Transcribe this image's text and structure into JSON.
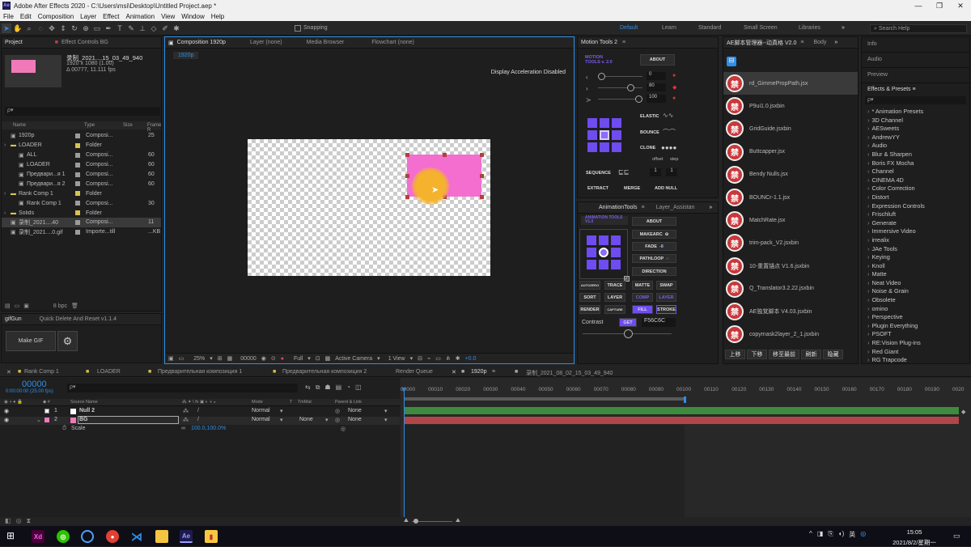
{
  "window": {
    "title": "Adobe After Effects 2020 - C:\\Users\\msi\\Desktop\\Untitled Project.aep *",
    "controls": [
      "—",
      "❐",
      "✕"
    ]
  },
  "menu": [
    "File",
    "Edit",
    "Composition",
    "Layer",
    "Effect",
    "Animation",
    "View",
    "Window",
    "Help"
  ],
  "toolbar": {
    "snapping": "Snapping",
    "workspaces": [
      "Default",
      "Learn",
      "Standard",
      "Small Screen",
      "Libraries"
    ],
    "search_placeholder": "Search Help"
  },
  "project": {
    "tab": "Project",
    "effect_controls": "Effect Controls BG",
    "thumb_name": "录制_2021....15_03_49_940",
    "thumb_info1": "1920 x 1080 (1.00)",
    "thumb_info2": "Δ 00777, 11.111 fps",
    "search_placeholder": "ρ▾",
    "cols": [
      "Name",
      "Type",
      "Size",
      "Frame R"
    ],
    "items": [
      {
        "name": "1920p",
        "type": "Composi...",
        "size": "25",
        "color": "#9c9c9c",
        "indent": 0,
        "kind": "comp"
      },
      {
        "name": "LOADER",
        "type": "Folder",
        "size": "",
        "color": "#d9c34a",
        "indent": 0,
        "kind": "folder"
      },
      {
        "name": "ALL",
        "type": "Composi...",
        "size": "60",
        "color": "#9c9c9c",
        "indent": 1,
        "kind": "comp"
      },
      {
        "name": "LOADER",
        "type": "Composi...",
        "size": "60",
        "color": "#9c9c9c",
        "indent": 1,
        "kind": "comp"
      },
      {
        "name": "Предвари...я 1",
        "type": "Composi...",
        "size": "60",
        "color": "#9c9c9c",
        "indent": 1,
        "kind": "comp"
      },
      {
        "name": "Предвари...я 2",
        "type": "Composi...",
        "size": "60",
        "color": "#9c9c9c",
        "indent": 1,
        "kind": "comp"
      },
      {
        "name": "Rank Comp 1",
        "type": "Folder",
        "size": "",
        "color": "#d9c34a",
        "indent": 0,
        "kind": "folder"
      },
      {
        "name": "Rank Comp 1",
        "type": "Composi...",
        "size": "30",
        "color": "#9c9c9c",
        "indent": 1,
        "kind": "comp"
      },
      {
        "name": "Solids",
        "type": "Folder",
        "size": "",
        "color": "#d9c34a",
        "indent": 0,
        "kind": "folder"
      },
      {
        "name": "录制_2021....40",
        "type": "Composi...",
        "size": "11",
        "color": "#9c9c9c",
        "indent": 0,
        "kind": "comp",
        "selected": true
      },
      {
        "name": "录制_2021....0.gif",
        "type": "Importe...till",
        "size": "...KB",
        "color": "#9c9c9c",
        "indent": 0,
        "kind": "file"
      }
    ],
    "bpc": "8 bpc"
  },
  "gifgun": {
    "tab": "gifGun",
    "tab2": "Quick Delete And Reset v1.1.4",
    "make": "Make GIF"
  },
  "comp": {
    "tab": "Composition 1920p",
    "tab_layer": "Layer (none)",
    "tab_media": "Media Browser",
    "tab_flow": "Flowchart (none)",
    "crumb": "1920p",
    "accel": "Display Acceleration Disabled",
    "zoom": "25%",
    "timecode": "00000",
    "quality": "Full",
    "camera": "Active Camera",
    "view": "1 View",
    "exposure": "+0.0"
  },
  "motion": {
    "tab": "Motion Tools 2",
    "logo": "MOTION TOOLS v. 2.0",
    "about": "ABOUT",
    "v1": "0",
    "v2": "80",
    "v3": "100",
    "elastic": "ELASTIC",
    "bounce": "BOUNCE",
    "clone": "CLONE",
    "offset": "offset",
    "step": "step",
    "sequence": "SEQUENCE",
    "s1": "1",
    "s2": "1",
    "extract": "EXTRACT",
    "merge": "MERGE",
    "addnull": "ADD NULL"
  },
  "anim": {
    "tab": "AnimationTools",
    "tab2": "Layer_Assistan",
    "logo": "ANIMATION TOOLS V1.0",
    "about": "ABOUT",
    "makearc": "MAKEARC",
    "fade": "FADE",
    "fadeval": "-8",
    "pathloop": "PATHLOOP",
    "direction": "DIRECTION",
    "btns1": [
      "AUTOZERO",
      "TRACE",
      "MATTE",
      "SWAP"
    ],
    "btns2": [
      "SORT",
      "LAYER",
      "COMP",
      "LAYER"
    ],
    "btns3": [
      "RENDER",
      "CAPTURE",
      "FILL",
      "STROKE"
    ],
    "contrast": "Contrast",
    "get": "GET",
    "hex": "F56C6C"
  },
  "scripts": {
    "tab": "AE脚本管理器--动真格 V2.0",
    "tab2": "Body",
    "items": [
      "rd_GimmePropPath.jsx",
      "P9ui1.0.jsxbin",
      "GridGuide.jsxbin",
      "Buttcapper.jsx",
      "Bendy Nulls.jsx",
      "BOUNCr-1.1.jsx",
      "MatchRate.jsx",
      "trim-pack_V2.jsxbin",
      "10-重置锚点 V1.6.jsxbin",
      "Q_Translator3.2.22.jsxbin",
      "AE独覚脚本 V4.03.jsxbin",
      "copymask2layer_2_1.jsxbin"
    ],
    "glyph": "禁",
    "buttons": [
      "上移",
      "下移",
      "移至最前",
      "刷新",
      "隐藏"
    ]
  },
  "effects": {
    "info": "Info",
    "audio": "Audio",
    "preview": "Preview",
    "tab": "Effects & Presets",
    "search_placeholder": "ρ▾",
    "items": [
      "* Animation Presets",
      "3D Channel",
      "AESweets",
      "AndrewYY",
      "Audio",
      "Blur & Sharpen",
      "Boris FX Mocha",
      "Channel",
      "CINEMA 4D",
      "Color Correction",
      "Distort",
      "Expression Controls",
      "Frischluft",
      "Generate",
      "Immersive Video",
      "irrealix",
      "JAe Tools",
      "Keying",
      "Knoll",
      "Matte",
      "Neat Video",
      "Noise & Grain",
      "Obsolete",
      "omino",
      "Perspective",
      "Plugin Everything",
      "PSOFT",
      "RE:Vision Plug-ins",
      "Red Giant",
      "RG Trapcode"
    ]
  },
  "timeline": {
    "tabs": [
      "Rank Comp 1",
      "LOADER",
      "Предварительная композиция 1",
      "Предварительная композиция 2",
      "Render Queue",
      "1920p",
      "录制_2021_08_02_15_03_49_940"
    ],
    "timecode": "00000",
    "fps": "0:00:00:00 (25.00 fps)",
    "search_placeholder": "ρ▾",
    "cols": {
      "src": "Source Name",
      "mode": "Mode",
      "t": "T",
      "trk": "TrkMat",
      "parent": "Parent & Link"
    },
    "layers": [
      {
        "num": "1",
        "name": "Null 2",
        "color": "#f0f0f0",
        "mode": "Normal",
        "trk": "",
        "parent": "None"
      },
      {
        "num": "2",
        "name": "BG",
        "color": "#f07ab8",
        "mode": "Normal",
        "trk": "None",
        "parent": "None"
      }
    ],
    "scale_label": "Scale",
    "scale_val": "100.0,100.0%",
    "ruler": [
      "00000",
      "00010",
      "00020",
      "00030",
      "00040",
      "00050",
      "00060",
      "00070",
      "00080",
      "00090",
      "00100",
      "00110",
      "00120",
      "00130",
      "00140",
      "00150",
      "00160",
      "00170",
      "00180",
      "00190",
      "0020"
    ]
  },
  "taskbar": {
    "time": "15:05",
    "date": "2021/8/2/星期一",
    "lang": "英"
  }
}
